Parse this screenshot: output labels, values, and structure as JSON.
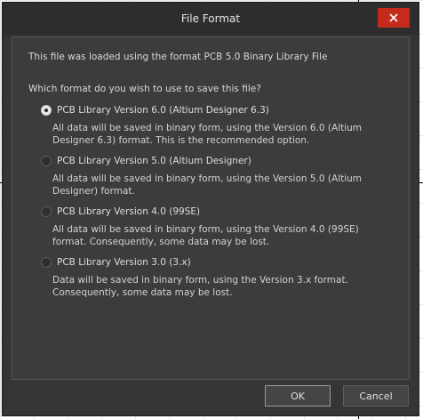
{
  "dialog": {
    "title": "File Format",
    "loaded_message": "This file was loaded using the format PCB 5.0 Binary Library File",
    "question": "Which format do you wish to use to save this file?",
    "options": [
      {
        "label": "PCB Library Version 6.0 (Altium Designer 6.3)",
        "description": "All data will be saved in binary form, using the Version 6.0 (Altium Designer 6.3) format. This is the recommended option.",
        "selected": true
      },
      {
        "label": "PCB Library Version 5.0 (Altium Designer)",
        "description": "All data will be saved in binary form, using the Version 5.0 (Altium Designer) format.",
        "selected": false
      },
      {
        "label": "PCB Library Version 4.0 (99SE)",
        "description": "All data will be saved in binary form, using the Version 4.0 (99SE) format. Consequently, some data may be lost.",
        "selected": false
      },
      {
        "label": "PCB Library Version 3.0 (3.x)",
        "description": "Data will be saved in binary form, using the Version 3.x format. Consequently, some data may be lost.",
        "selected": false
      }
    ],
    "buttons": {
      "ok": "OK",
      "cancel": "Cancel"
    },
    "colors": {
      "close_button": "#c42b1c",
      "dialog_bg": "#353535",
      "panel_bg": "#3c3c3c"
    }
  }
}
